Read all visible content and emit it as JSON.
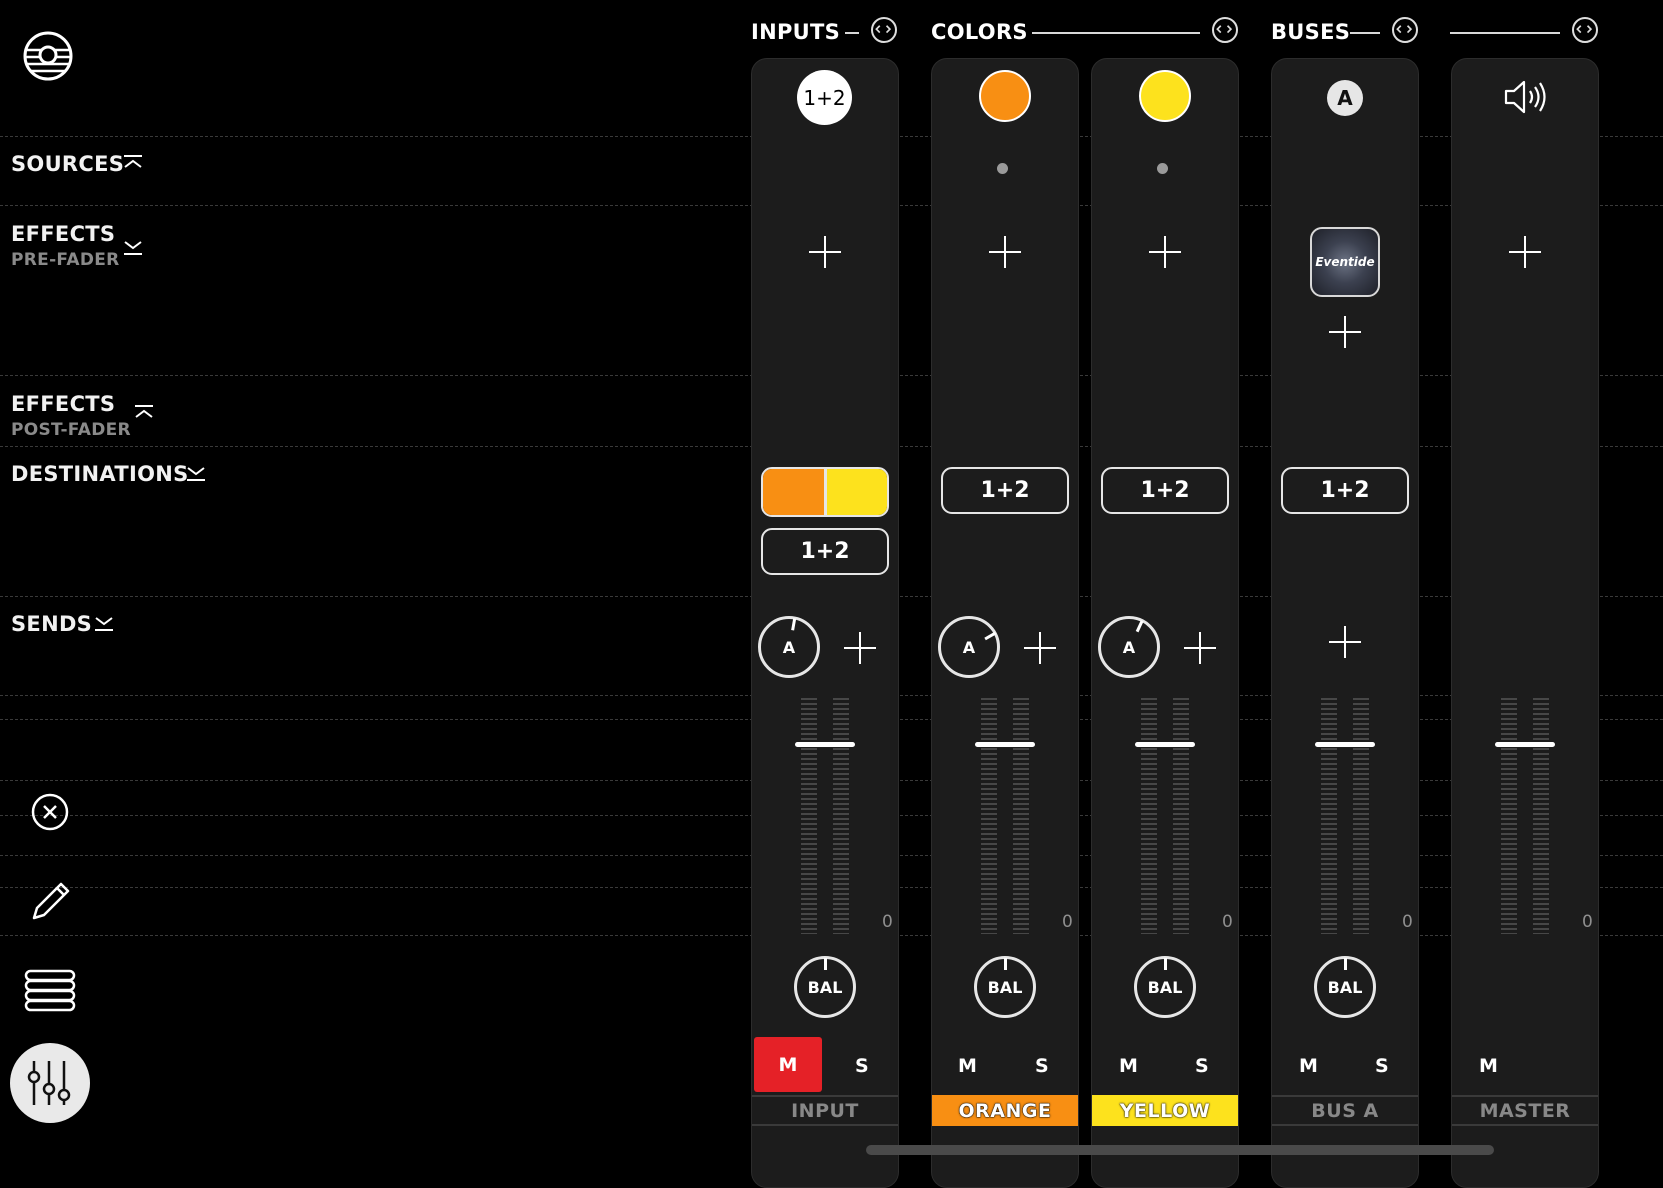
{
  "sections": {
    "sources": "SOURCES",
    "effects_pre": {
      "title": "EFFECTS",
      "sub": "PRE-FADER"
    },
    "effects_post": {
      "title": "EFFECTS",
      "sub": "POST-FADER"
    },
    "destinations": "DESTINATIONS",
    "sends": "SENDS"
  },
  "headers": {
    "inputs": "INPUTS",
    "colors": "COLORS",
    "buses": "BUSES"
  },
  "channels": {
    "input": {
      "badge": "1+2",
      "dest_pill": "1+2",
      "send_knob": "A",
      "bal": "BAL",
      "mute": "M",
      "solo": "S",
      "zero": "0",
      "name": "INPUT",
      "dest_colors": [
        "#f88f13",
        "#fde21d"
      ]
    },
    "orange": {
      "color": "#f88f13",
      "dest_pill": "1+2",
      "send_knob": "A",
      "bal": "BAL",
      "mute": "M",
      "solo": "S",
      "zero": "0",
      "name": "ORANGE"
    },
    "yellow": {
      "color": "#fde21d",
      "dest_pill": "1+2",
      "send_knob": "A",
      "bal": "BAL",
      "mute": "M",
      "solo": "S",
      "zero": "0",
      "name": "YELLOW"
    },
    "bus_a": {
      "badge": "A",
      "effect": "Eventide",
      "dest_pill": "1+2",
      "bal": "BAL",
      "mute": "M",
      "solo": "S",
      "zero": "0",
      "name": "BUS A"
    },
    "master": {
      "icon": "speaker-icon",
      "mute": "M",
      "zero": "0",
      "name": "MASTER"
    }
  },
  "colors": {
    "mute_active": "#e52127",
    "orange": "#f88f13",
    "yellow": "#fde21d"
  }
}
